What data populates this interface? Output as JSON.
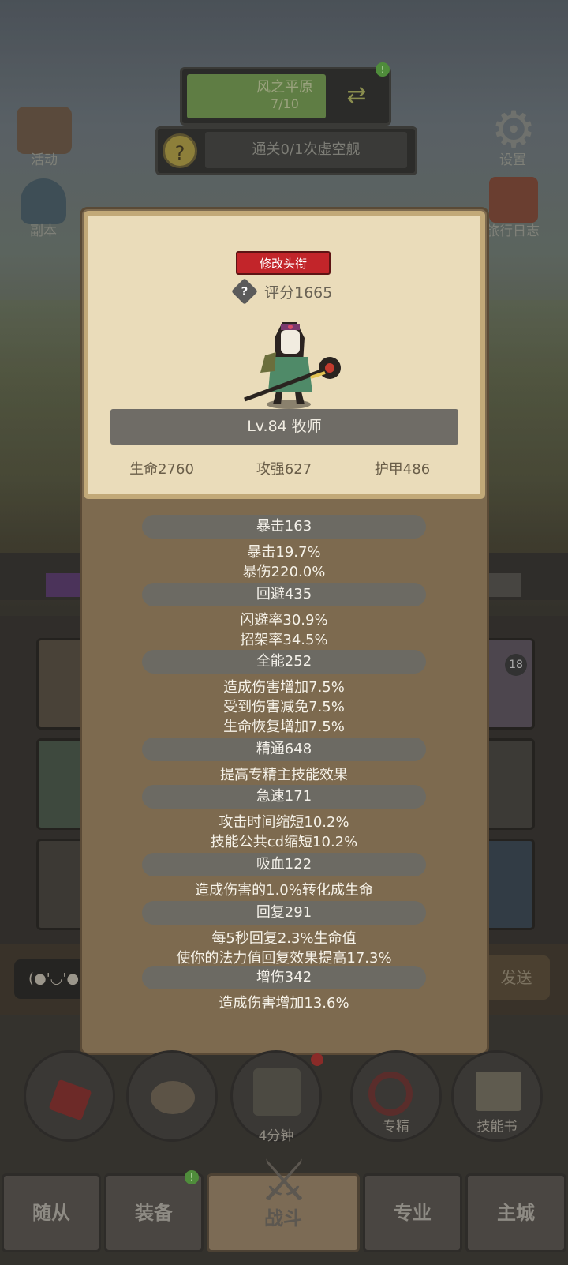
{
  "region": {
    "name": "风之平原",
    "progress": "7/10",
    "switch_icon": "swap-arrows-icon",
    "alert": "!"
  },
  "quest": {
    "icon": "question-coin-icon",
    "text": "通关0/1次虚空舰"
  },
  "left_menu": [
    {
      "label": "活动",
      "icon": "scroll-board-icon"
    },
    {
      "label": "副本",
      "icon": "portal-icon"
    }
  ],
  "right_menu": [
    {
      "label": "设置",
      "icon": "gear-icon"
    },
    {
      "label": "旅行日志",
      "icon": "journal-book-icon"
    }
  ],
  "profile": {
    "change_title_label": "修改头衔",
    "help_icon": "?",
    "score": "评分1665",
    "name_bar": "Lv.84 牧师",
    "hp": "生命2760",
    "attack": "攻强627",
    "armor": "护甲486"
  },
  "stats": [
    {
      "header": "暴击163",
      "lines": [
        "暴击19.7%",
        "暴伤220.0%"
      ]
    },
    {
      "header": "回避435",
      "lines": [
        "闪避率30.9%",
        "招架率34.5%"
      ]
    },
    {
      "header": "全能252",
      "lines": [
        "造成伤害增加7.5%",
        "受到伤害减免7.5%",
        "生命恢复增加7.5%"
      ]
    },
    {
      "header": "精通648",
      "lines": [
        "提高专精主技能效果"
      ]
    },
    {
      "header": "急速171",
      "lines": [
        "攻击时间缩短10.2%",
        "技能公共cd缩短10.2%"
      ]
    },
    {
      "header": "吸血122",
      "lines": [
        "造成伤害的1.0%转化成生命"
      ]
    },
    {
      "header": "回复291",
      "lines": [
        "每5秒回复2.3%生命值",
        "使你的法力值回复效果提高17.3%"
      ]
    },
    {
      "header": "增伤342",
      "lines": [
        "造成伤害增加13.6%"
      ]
    }
  ],
  "background_partial": {
    "badge_count": "18",
    "chat_prefix": "(●'◡'●",
    "send_label": "发送"
  },
  "action_buttons": [
    {
      "label": "",
      "icon": "red-potion-icon"
    },
    {
      "label": "",
      "icon": "bread-icon"
    },
    {
      "label": "4分钟",
      "icon": "treasure-chest-icon"
    },
    {
      "label": "专精",
      "icon": "specialization-icon"
    },
    {
      "label": "技能书",
      "icon": "skill-book-icon"
    }
  ],
  "tabs": [
    {
      "label": "随从"
    },
    {
      "label": "装备"
    },
    {
      "label": "战斗"
    },
    {
      "label": "专业"
    },
    {
      "label": "主城"
    }
  ],
  "colors": {
    "title_button": "#c2252a",
    "panel": "#7d6a4f",
    "card": "#eadcba",
    "stat_header": "#6c6a63"
  }
}
